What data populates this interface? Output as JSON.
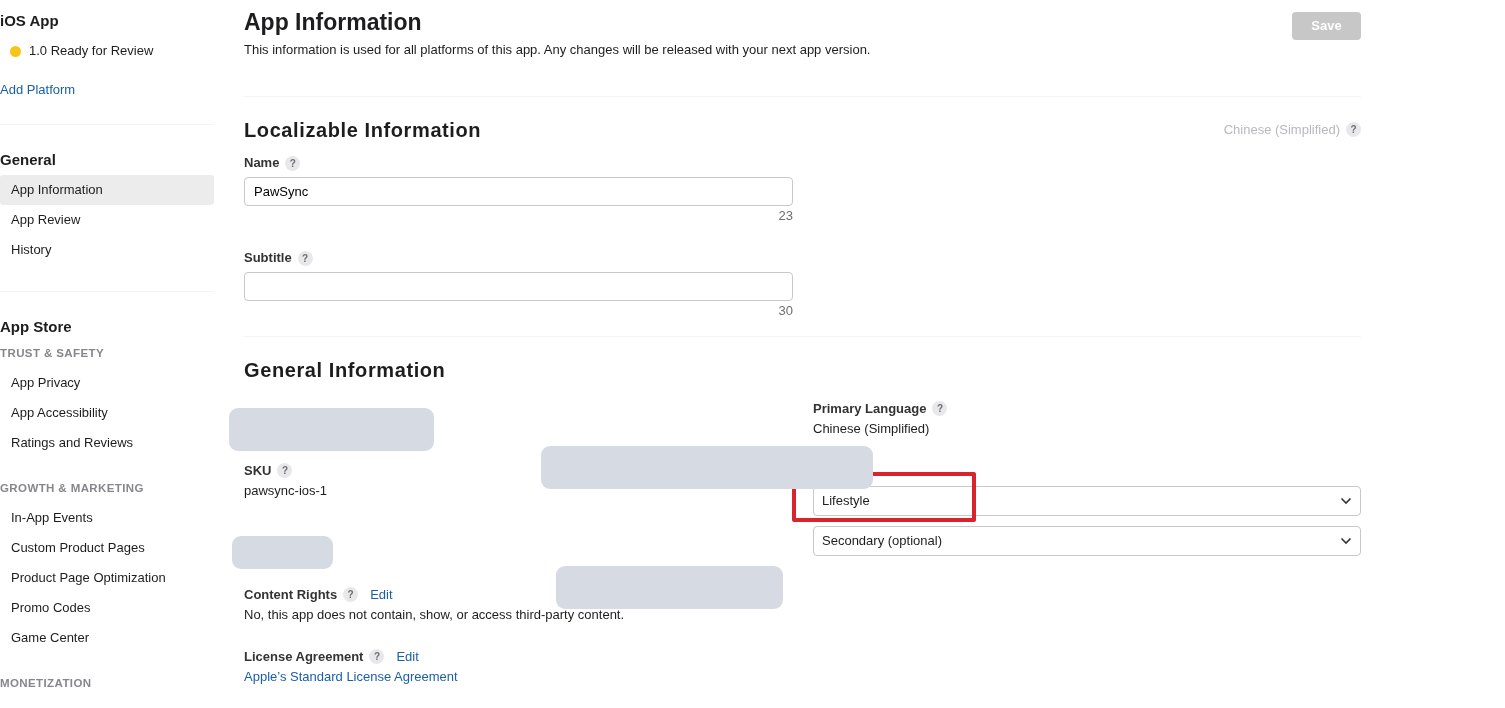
{
  "sidebar": {
    "app_title": "iOS App",
    "version": {
      "label": "1.0 Ready for Review",
      "color": "#f5c518"
    },
    "add_platform": "Add Platform",
    "sections": [
      {
        "title": "General",
        "groups": [
          {
            "items": [
              {
                "label": "App Information",
                "selected": true
              },
              {
                "label": "App Review",
                "selected": false
              },
              {
                "label": "History",
                "selected": false
              }
            ]
          }
        ]
      },
      {
        "title": "App Store",
        "groups": [
          {
            "heading": "TRUST & SAFETY",
            "items": [
              {
                "label": "App Privacy",
                "selected": false
              },
              {
                "label": "App Accessibility",
                "selected": false
              },
              {
                "label": "Ratings and Reviews",
                "selected": false
              }
            ]
          },
          {
            "heading": "GROWTH & MARKETING",
            "items": [
              {
                "label": "In-App Events",
                "selected": false
              },
              {
                "label": "Custom Product Pages",
                "selected": false
              },
              {
                "label": "Product Page Optimization",
                "selected": false
              },
              {
                "label": "Promo Codes",
                "selected": false
              },
              {
                "label": "Game Center",
                "selected": false
              }
            ]
          },
          {
            "heading": "MONETIZATION"
          }
        ]
      }
    ]
  },
  "page": {
    "title": "App Information",
    "description": "This information is used for all platforms of this app. Any changes will be released with your next app version.",
    "save_button": {
      "label": "Save",
      "disabled": true
    }
  },
  "localizable": {
    "title": "Localizable Information",
    "language": "Chinese (Simplified)",
    "language_help": "?",
    "fields": [
      {
        "label": "Name",
        "help": "?",
        "value": "PawSync",
        "count": "23"
      },
      {
        "label": "Subtitle",
        "help": "?",
        "count": "30"
      }
    ]
  },
  "general": {
    "title": "General Information",
    "left": [
      {
        "kind": "redacted"
      },
      {
        "label": "SKU",
        "help": "?",
        "value": "pawsync-ios-1",
        "kind": "text"
      },
      {
        "kind": "redacted"
      },
      {
        "label": "Content Rights",
        "help": "?",
        "edit": "Edit",
        "value": "No, this app does not contain, show, or access third-party content.",
        "kind": "text"
      },
      {
        "label": "License Agreement",
        "help": "?",
        "edit": "Edit",
        "value": "Apple’s Standard License Agreement",
        "kind": "link"
      }
    ],
    "primary_language": {
      "label": "Primary Language",
      "help": "?",
      "value": "Chinese (Simplified)"
    },
    "selects": [
      {
        "value": "Lifestyle",
        "highlighted": true
      },
      {
        "value": "Secondary (optional)",
        "highlighted": false
      }
    ]
  }
}
